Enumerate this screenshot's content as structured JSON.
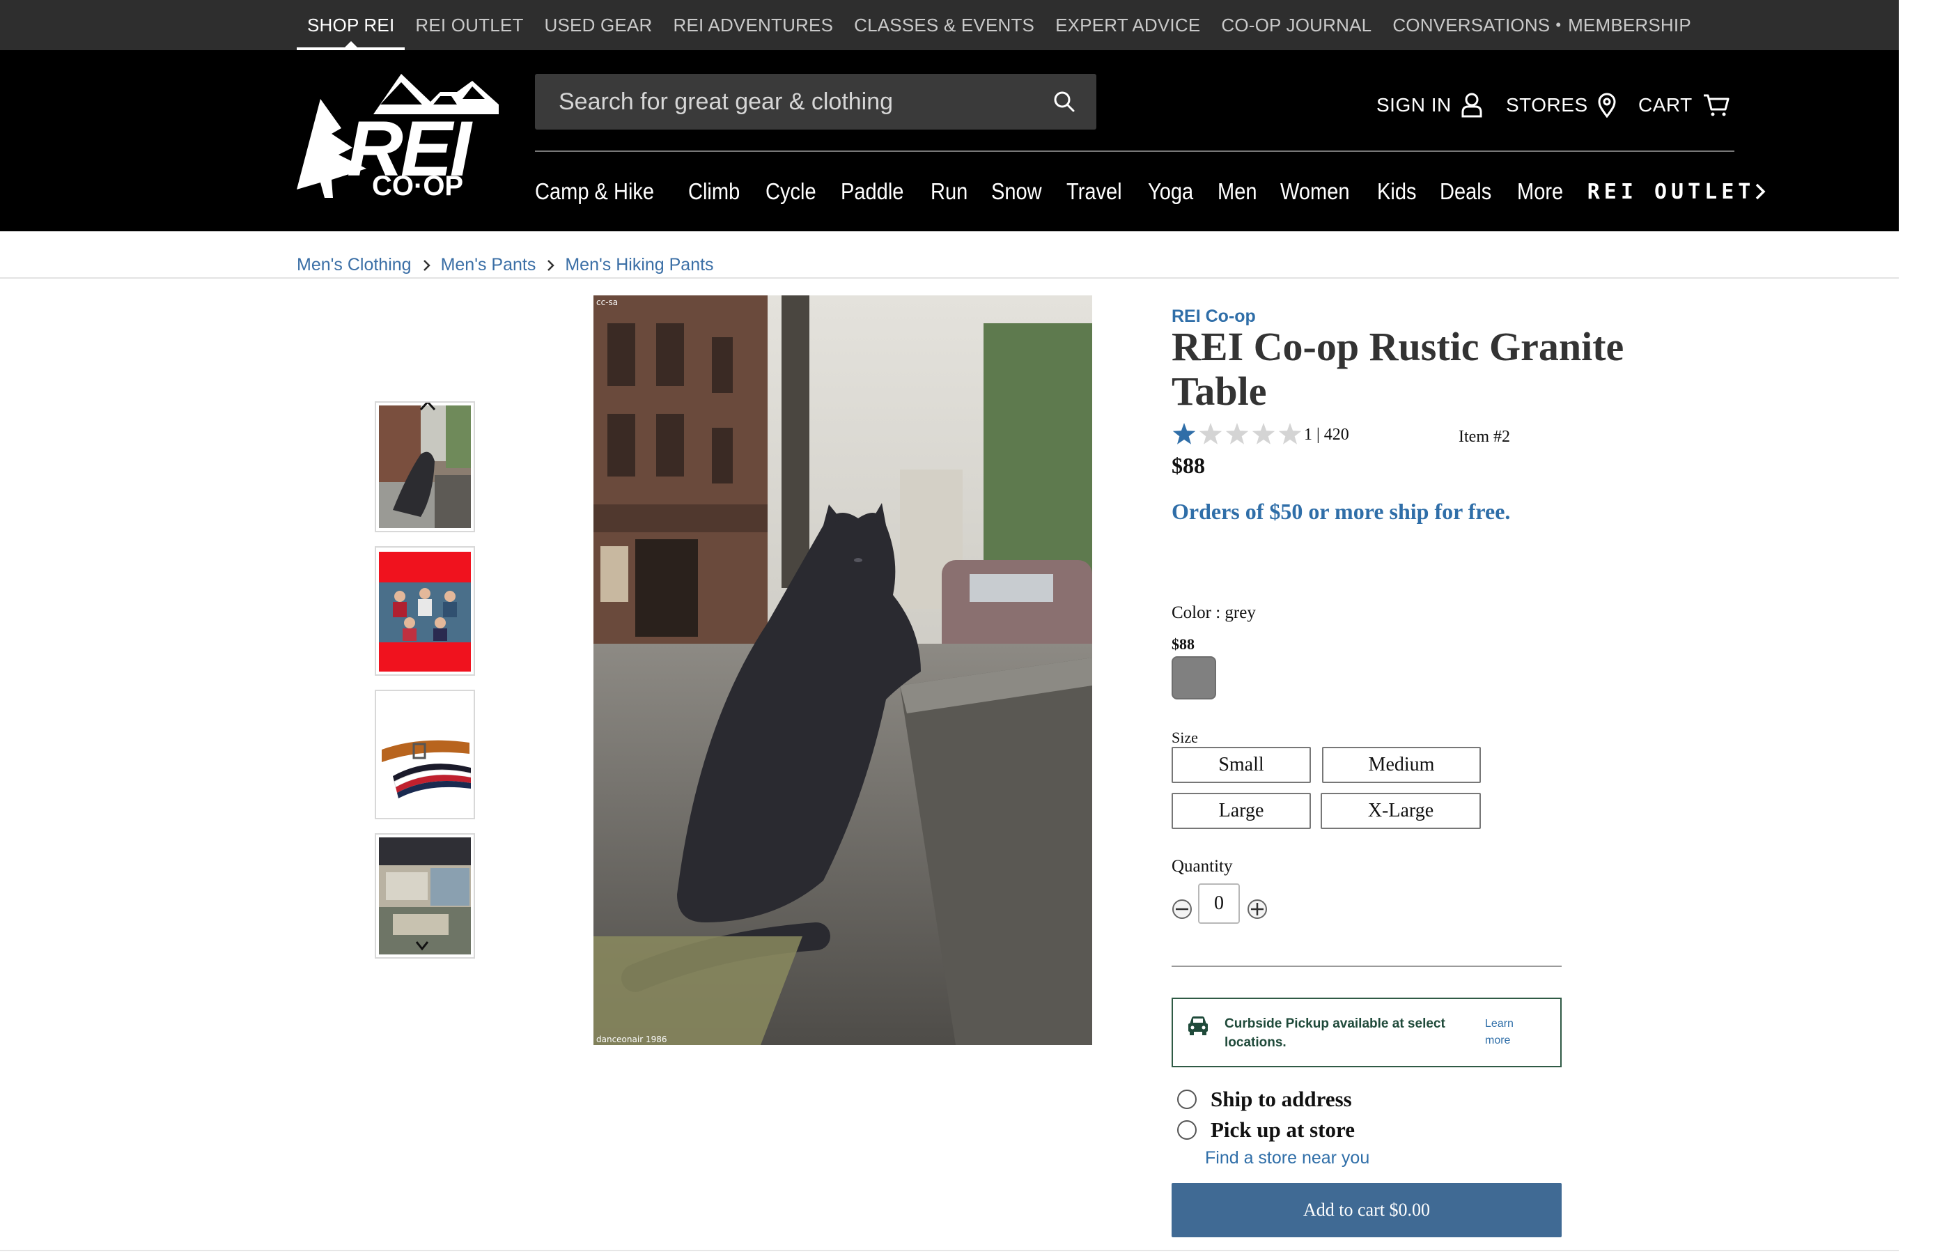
{
  "topbar": {
    "links": [
      "SHOP REI",
      "REI OUTLET",
      "USED GEAR",
      "REI ADVENTURES",
      "CLASSES & EVENTS",
      "EXPERT ADVICE",
      "CO-OP JOURNAL",
      "CONVERSATIONS",
      "MEMBERSHIP"
    ],
    "active": "SHOP REI"
  },
  "header": {
    "logo_text": "REI",
    "logo_sub": "CO·OP",
    "search_placeholder": "Search for great gear & clothing",
    "sign_in": "SIGN IN",
    "stores": "STORES",
    "cart": "CART",
    "categories": [
      "Camp & Hike",
      "Climb",
      "Cycle",
      "Paddle",
      "Run",
      "Snow",
      "Travel",
      "Yoga",
      "Men",
      "Women",
      "Kids",
      "Deals",
      "More"
    ],
    "outlet": "REI OUTLET"
  },
  "breadcrumb": [
    "Men's Clothing",
    "Men's Pants",
    "Men's Hiking Pants"
  ],
  "product": {
    "brand": "REI Co-op",
    "title": "REI Co-op Rustic Granite Table",
    "rating_value": 1,
    "rating_max": 5,
    "rating_text": "1 | 420",
    "item_number": "Item #2",
    "price": "$88",
    "shipping_message": "Orders of $50 or more ship for free.",
    "color_label": "Color : grey",
    "swatch_price": "$88",
    "swatch_color": "#808080",
    "size_label": "Size",
    "sizes": [
      "Small",
      "Medium",
      "Large",
      "X-Large"
    ],
    "quantity_label": "Quantity",
    "quantity": "0",
    "pickup_text": "Curbside Pickup available at select locations.",
    "pickup_learn": "Learn more",
    "ship_option": "Ship to address",
    "pickup_option": "Pick up at store",
    "find_store": "Find a store near you",
    "add_to_cart": "Add to cart $0.00"
  },
  "gallery": {
    "main_image_caption": "danceonair 1986",
    "main_image_tag": "cc-sa"
  },
  "colors": {
    "brand_blue": "#2f6ea8",
    "header_black": "#000000",
    "topbar_gray": "#2e2e2e",
    "button_blue": "#406a94"
  }
}
